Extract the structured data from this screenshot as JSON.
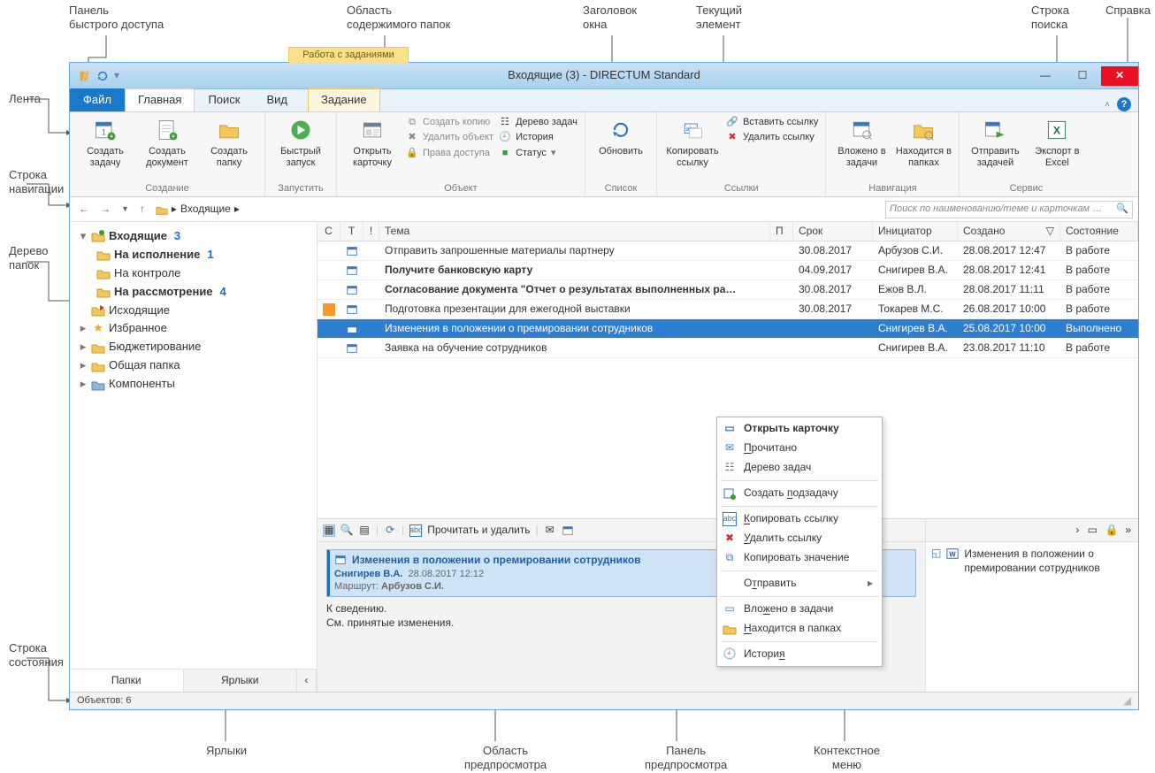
{
  "callouts": {
    "qat": "Панель\nбыстрого доступа",
    "content_area": "Область\nсодержимого папок",
    "title": "Заголовок\nокна",
    "current_item": "Текущий\nэлемент",
    "search": "Строка\nпоиска",
    "help": "Справка",
    "ribbon": "Лента",
    "nav": "Строка\nнавигации",
    "tree": "Дерево\nпапок",
    "status": "Строка\nсостояния",
    "shortcuts": "Ярлыки",
    "preview_area": "Область\nпредпросмотра",
    "preview_panel": "Панель\nпредпросмотра",
    "context_menu": "Контекстное\nменю"
  },
  "window": {
    "title": "Входящие (3) - DIRECTUM Standard"
  },
  "tabs": {
    "file": "Файл",
    "home": "Главная",
    "search": "Поиск",
    "view": "Вид",
    "context_title": "Работа с заданиями",
    "task": "Задание"
  },
  "ribbon": {
    "g_create": "Создание",
    "create_task": "Создать\nзадачу",
    "create_doc": "Создать\nдокумент",
    "create_folder": "Создать\nпапку",
    "g_launch": "Запустить",
    "quick_start": "Быстрый\nзапуск",
    "open_card": "Открыть\nкарточку",
    "g_object": "Объект",
    "copy": "Создать копию",
    "deleteobj": "Удалить объект",
    "rights": "Права доступа",
    "task_tree": "Дерево задач",
    "history": "История",
    "status": "Статус",
    "g_list": "Список",
    "refresh": "Обновить",
    "copy_link": "Копировать\nссылку",
    "g_links": "Ссылки",
    "paste_link": "Вставить ссылку",
    "delete_link": "Удалить ссылку",
    "g_nav": "Навигация",
    "in_tasks": "Вложено\nв задачи",
    "in_folders": "Находится\nв папках",
    "g_service": "Сервис",
    "send_tasks": "Отправить\nзадачей",
    "export_excel": "Экспорт\nв Excel"
  },
  "nav": {
    "crumb_root": "Входящие",
    "search_ph": "Поиск по наименованию/теме и карточкам …"
  },
  "tree": {
    "root": "Входящие",
    "root_count": 3,
    "exec": "На исполнение",
    "exec_count": 1,
    "control": "На контроле",
    "review": "На рассмотрение",
    "review_count": 4,
    "outbox": "Исходящие",
    "fav": "Избранное",
    "budget": "Бюджетирование",
    "common": "Общая папка",
    "components": "Компоненты"
  },
  "bottom_tabs": {
    "folders": "Папки",
    "shortcuts": "Ярлыки"
  },
  "grid": {
    "cols": {
      "c": "С",
      "t": "Т",
      "b": "!",
      "theme": "Тема",
      "p": "П",
      "date": "Срок",
      "init": "Инициатор",
      "created": "Создано",
      "state": "Состояние"
    },
    "rows": [
      {
        "flag": "",
        "theme": "Отправить запрошенные материалы партнеру",
        "date": "30.08.2017",
        "init": "Арбузов С.И.",
        "created": "28.08.2017 12:47",
        "state": "В работе",
        "bold": false
      },
      {
        "flag": "",
        "theme": "Получите банковскую карту",
        "date": "04.09.2017",
        "init": "Снигирев В.А.",
        "created": "28.08.2017 12:41",
        "state": "В работе",
        "bold": true
      },
      {
        "flag": "",
        "theme": "Согласование документа \"Отчет о результатах выполненных ра…",
        "date": "30.08.2017",
        "init": "Ежов В.Л.",
        "created": "28.08.2017 11:11",
        "state": "В работе",
        "bold": true
      },
      {
        "flag": "orange",
        "theme": "Подготовка презентации для ежегодной выставки",
        "date": "30.08.2017",
        "init": "Токарев М.С.",
        "created": "26.08.2017 10:00",
        "state": "В работе",
        "bold": false
      },
      {
        "flag": "",
        "theme": "Изменения в положении о премировании сотрудников",
        "date": "",
        "init": "Снигирев В.А.",
        "created": "25.08.2017 10:00",
        "state": "Выполнено",
        "bold": false,
        "selected": true
      },
      {
        "flag": "",
        "theme": "Заявка на обучение сотрудников",
        "date": "",
        "init": "Снигирев В.А.",
        "created": "23.08.2017 11:10",
        "state": "В работе",
        "bold": false
      }
    ]
  },
  "preview": {
    "read_delete": "Прочитать и удалить",
    "title": "Изменения в положении о премировании сотрудников",
    "author": "Снигирев В.А.",
    "created": "28.08.2017 12:12",
    "route_label": "Маршрут:",
    "route_value": "Арбузов С.И.",
    "body1": "К сведению.",
    "body2": "См. принятые изменения.",
    "doc_title": "Изменения в положении о премировании сотрудников"
  },
  "status": {
    "objects_label": "Объектов:",
    "count": "6"
  },
  "ctx": {
    "open": "Открыть карточку",
    "read": "Прочитано",
    "tree": "Дерево задач",
    "subtask": "Создать подзадачу",
    "copy_link": "Копировать ссылку",
    "del_link": "Удалить ссылку",
    "copy_value": "Копировать значение",
    "send": "Отправить",
    "in_tasks": "Вложено в задачи",
    "in_folders": "Находится в папках",
    "history": "История"
  }
}
